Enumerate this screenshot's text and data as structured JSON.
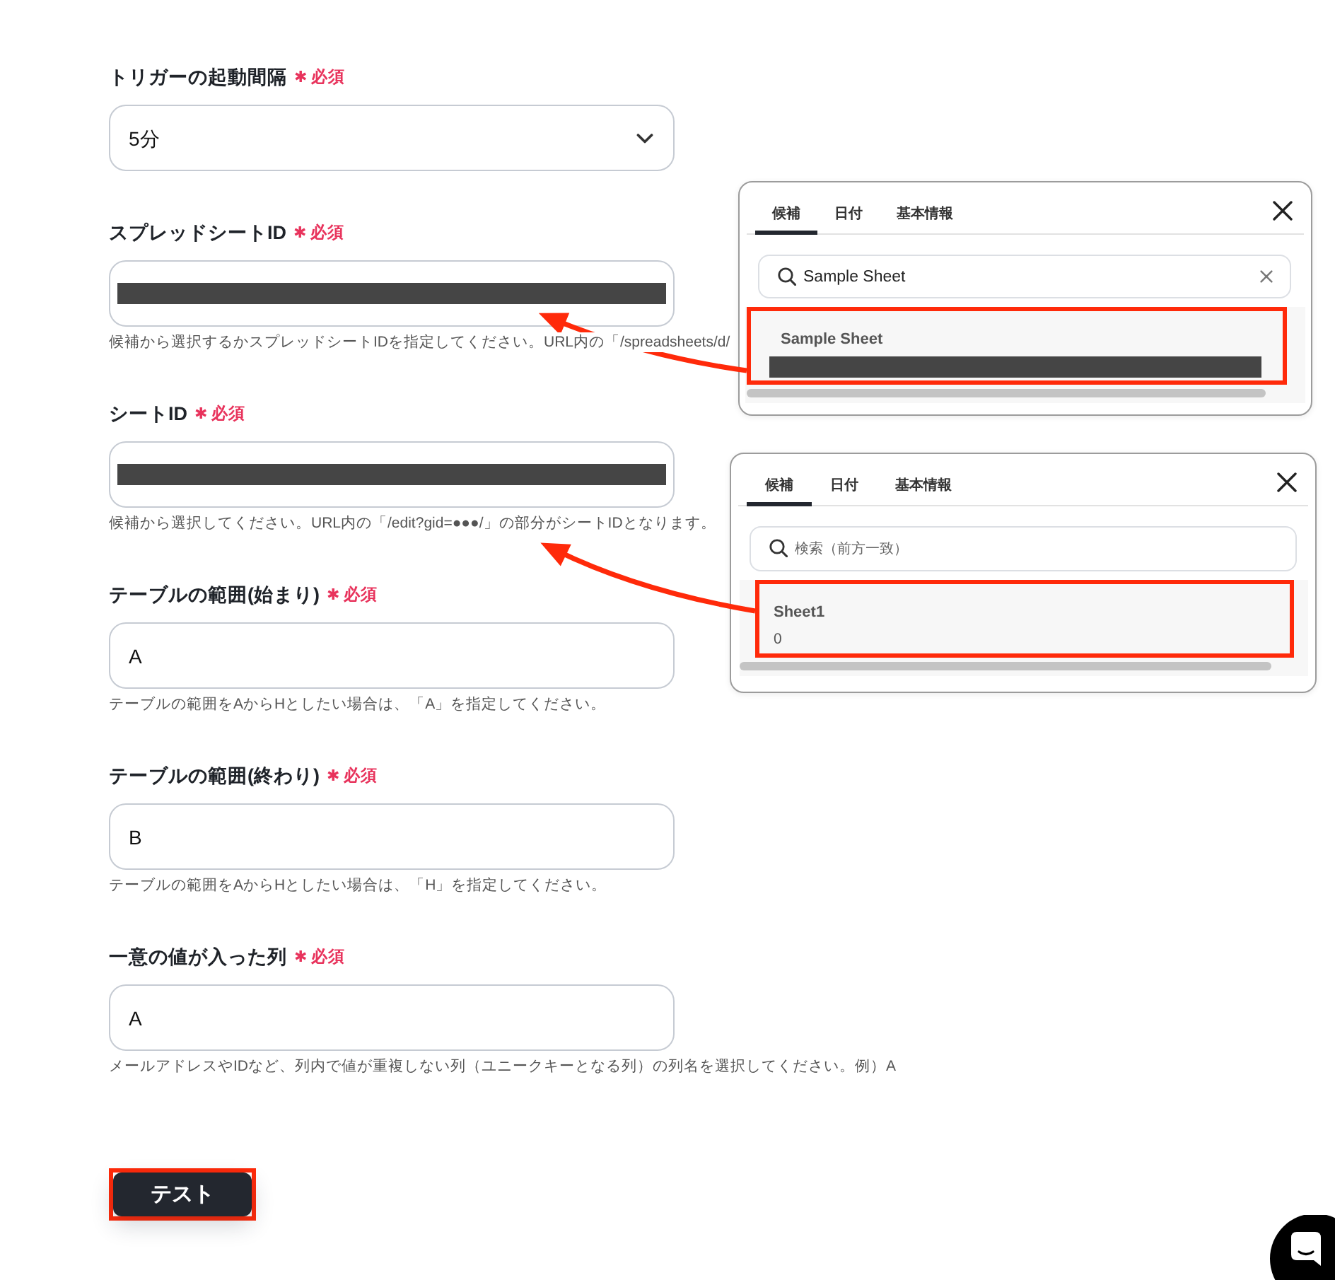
{
  "fields": [
    {
      "kind": "select",
      "label": "トリガーの起動間隔",
      "required_mark": "✱",
      "required_text": "必須",
      "redacted": false,
      "value": "5分"
    },
    {
      "kind": "text",
      "label": "スプレッドシートID",
      "required_mark": "✱",
      "required_text": "必須",
      "redacted": true,
      "help": "候補から選択するかスプレッドシートIDを指定してください。URL内の「/spreadsheets/d/"
    },
    {
      "kind": "text",
      "label": "シートID",
      "required_mark": "✱",
      "required_text": "必須",
      "redacted": true,
      "help": "候補から選択してください。URL内の「/edit?gid=●●●/」の部分がシートIDとなります。"
    },
    {
      "kind": "text",
      "label": "テーブルの範囲(始まり)",
      "required_mark": "✱",
      "required_text": "必須",
      "redacted": false,
      "value": "A",
      "help": "テーブルの範囲をAからHとしたい場合は、「A」を指定してください。"
    },
    {
      "kind": "text",
      "label": "テーブルの範囲(終わり)",
      "required_mark": "✱",
      "required_text": "必須",
      "redacted": false,
      "value": "B",
      "help": "テーブルの範囲をAからHとしたい場合は、「H」を指定してください。"
    },
    {
      "kind": "text",
      "label": "一意の値が入った列",
      "required_mark": "✱",
      "required_text": "必須",
      "redacted": false,
      "value": "A",
      "help": "メールアドレスやIDなど、列内で値が重複しない列（ユニークキーとなる列）の列名を選択してください。例）A"
    }
  ],
  "test_button": {
    "label": "テスト",
    "highlighted": true
  },
  "popups": [
    {
      "tabs": [
        {
          "label": "候補",
          "selected": true
        },
        {
          "label": "日付",
          "selected": false
        },
        {
          "label": "基本情報",
          "selected": false
        }
      ],
      "search": {
        "value": "Sample Sheet"
      },
      "results": [
        {
          "title": "Sample Sheet",
          "redacted": true,
          "highlighted": true
        }
      ]
    },
    {
      "tabs": [
        {
          "label": "候補",
          "selected": true
        },
        {
          "label": "日付",
          "selected": false
        },
        {
          "label": "基本情報",
          "selected": false
        }
      ],
      "search": {
        "placeholder": "検索（前方一致）"
      },
      "results": [
        {
          "title": "Sheet1",
          "subtitle": "0",
          "redacted": false,
          "highlighted": true
        }
      ]
    }
  ]
}
